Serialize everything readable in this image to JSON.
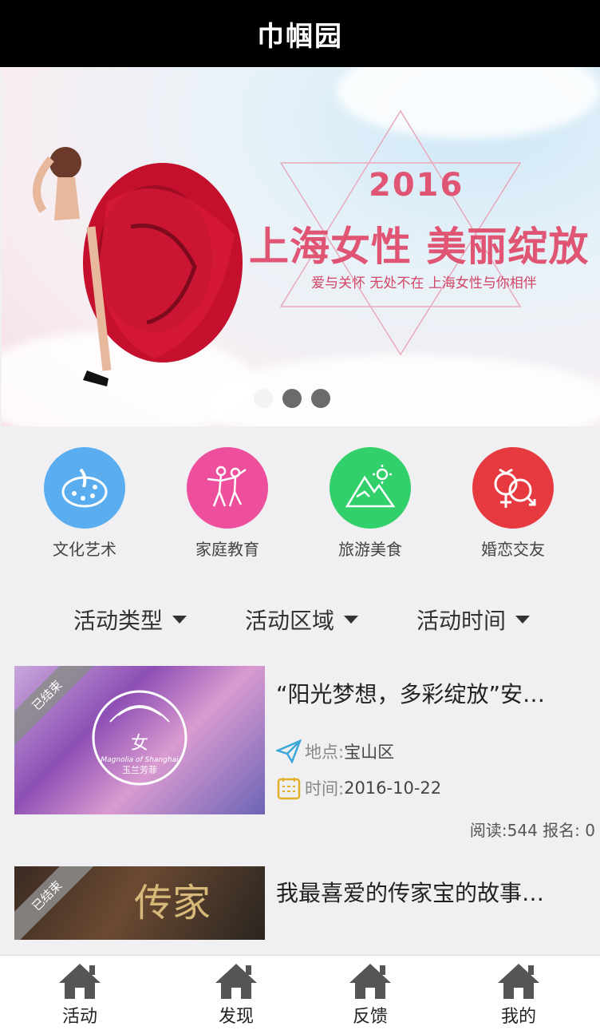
{
  "header": {
    "title": "巾帼园"
  },
  "banner": {
    "year": "2016",
    "headline": "上海女性 美丽绽放",
    "subline": "爱与关怀 无处不在 上海女性与你相伴",
    "slides": 3,
    "active_slide": 1
  },
  "categories": [
    {
      "label": "文化艺术",
      "icon": "palette-icon",
      "color": "#5aaef0"
    },
    {
      "label": "家庭教育",
      "icon": "dancers-icon",
      "color": "#ee4f9c"
    },
    {
      "label": "旅游美食",
      "icon": "mountain-sun-icon",
      "color": "#31d06a"
    },
    {
      "label": "婚恋交友",
      "icon": "gender-rings-icon",
      "color": "#e63a40"
    }
  ],
  "filters": {
    "type": "活动类型",
    "area": "活动区域",
    "time": "活动时间"
  },
  "activities": [
    {
      "status": "已结束",
      "title": "“阳光梦想，多彩绽放”安…",
      "location_key": "地点:",
      "location": "宝山区",
      "time_key": "时间:",
      "time": "2016-10-22",
      "stats": "阅读:544 报名: 0",
      "thumb_text": "Magnolia of Shanghai",
      "thumb_text2": "玉兰芳菲",
      "thumb_glyph": "女"
    },
    {
      "status": "已结束",
      "title": "我最喜爱的传家宝的故事…",
      "thumb_text": "传家"
    }
  ],
  "tabbar": [
    {
      "label": "活动",
      "icon": "home-icon"
    },
    {
      "label": "发现",
      "icon": "home-icon"
    },
    {
      "label": "反馈",
      "icon": "home-icon"
    },
    {
      "label": "我的",
      "icon": "home-icon"
    }
  ],
  "colors": {
    "accent_pink": "#e05573",
    "topbar": "#000000",
    "page_bg": "#f0f0f2"
  }
}
